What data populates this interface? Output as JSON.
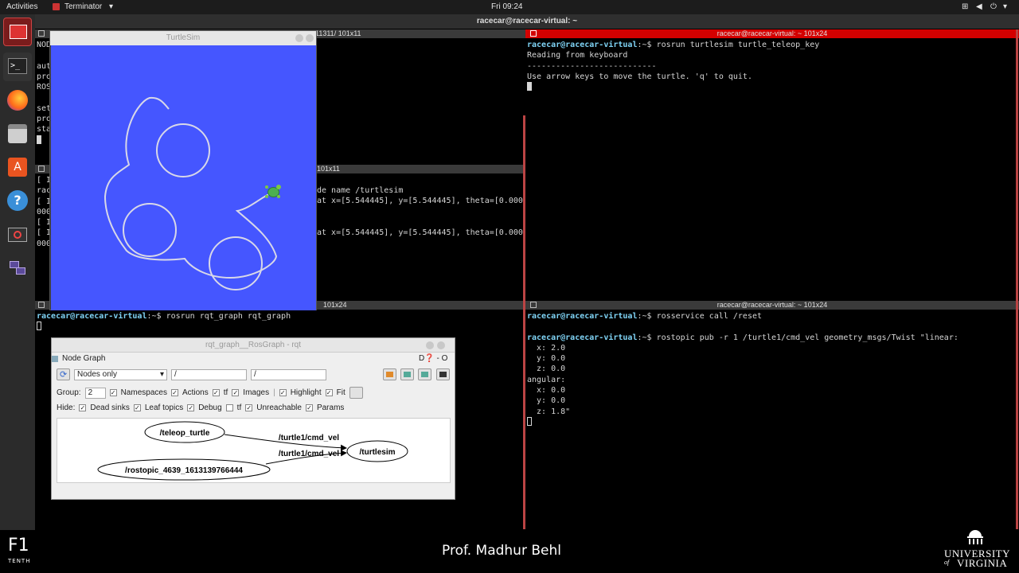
{
  "topbar": {
    "activities": "Activities",
    "app_menu": "Terminator",
    "clock": "Fri 09:24"
  },
  "window": {
    "title": "racecar@racecar-virtual: ~"
  },
  "panes": {
    "top_left": {
      "title": "11311/ 101x11",
      "lines": [
        "NOD",
        "",
        "aut",
        "pro",
        "ROS",
        "",
        "set",
        "pro",
        "sta"
      ]
    },
    "mid_left": {
      "title": "101x11",
      "prefix_lines": [
        "[ I",
        "rac",
        "[ I",
        "000",
        "[ I",
        "[ I",
        "000"
      ],
      "line1": "de name /turtlesim",
      "line2": "at x=[5.544445], y=[5.544445], theta=[0.000",
      "line3": "at x=[5.544445], y=[5.544445], theta=[0.000"
    },
    "top_right": {
      "title": "racecar@racecar-virtual: ~ 101x24",
      "prompt": "racecar@racecar-virtual",
      "command": ":~$ rosrun turtlesim turtle_teleop_key",
      "line1": "Reading from keyboard",
      "line2": "---------------------------",
      "line3": "Use arrow keys to move the turtle. 'q' to quit."
    },
    "bottom_left": {
      "title": "101x24",
      "prompt": "racecar@racecar-virtual",
      "command": ":~$ rosrun rqt_graph rqt_graph"
    },
    "bottom_right": {
      "title": "racecar@racecar-virtual: ~ 101x24",
      "prompt": "racecar@racecar-virtual",
      "command1": ":~$ rosservice call /reset",
      "command2": ":~$ rostopic pub -r 1 /turtle1/cmd_vel geometry_msgs/Twist \"linear:",
      "lines": [
        "  x: 2.0",
        "  y: 0.0",
        "  z: 0.0",
        "angular:",
        "  x: 0.0",
        "  y: 0.0",
        "  z: 1.8\""
      ]
    }
  },
  "turtlesim": {
    "title": "TurtleSim"
  },
  "rqt": {
    "title": "rqt_graph__RosGraph - rqt",
    "plugin": "Node Graph",
    "plugin_controls": "D",
    "dash": "-",
    "o": "O",
    "mode": "Nodes only",
    "filter1": "/",
    "filter2": "/",
    "group_label": "Group:",
    "group_value": "2",
    "opts": {
      "namespaces": "Namespaces",
      "actions": "Actions",
      "tf": "tf",
      "images": "Images",
      "highlight": "Highlight",
      "fit": "Fit"
    },
    "hide_label": "Hide:",
    "hide": {
      "dead_sinks": "Dead sinks",
      "leaf_topics": "Leaf topics",
      "debug": "Debug",
      "tf": "tf",
      "unreachable": "Unreachable",
      "params": "Params"
    },
    "graph": {
      "node_teleop": "/teleop_turtle",
      "node_rostopic": "/rostopic_4639_1613139766444",
      "node_turtlesim": "/turtlesim",
      "edge1": "/turtle1/cmd_vel",
      "edge2": "/turtle1/cmd_vel"
    }
  },
  "brand": {
    "logo": "F1",
    "logo_sub": "TENTH",
    "presenter": "Prof. Madhur Behl",
    "university_top": "UNIVERSITY",
    "university_bottom": "VIRGINIA",
    "university_of": "of"
  }
}
